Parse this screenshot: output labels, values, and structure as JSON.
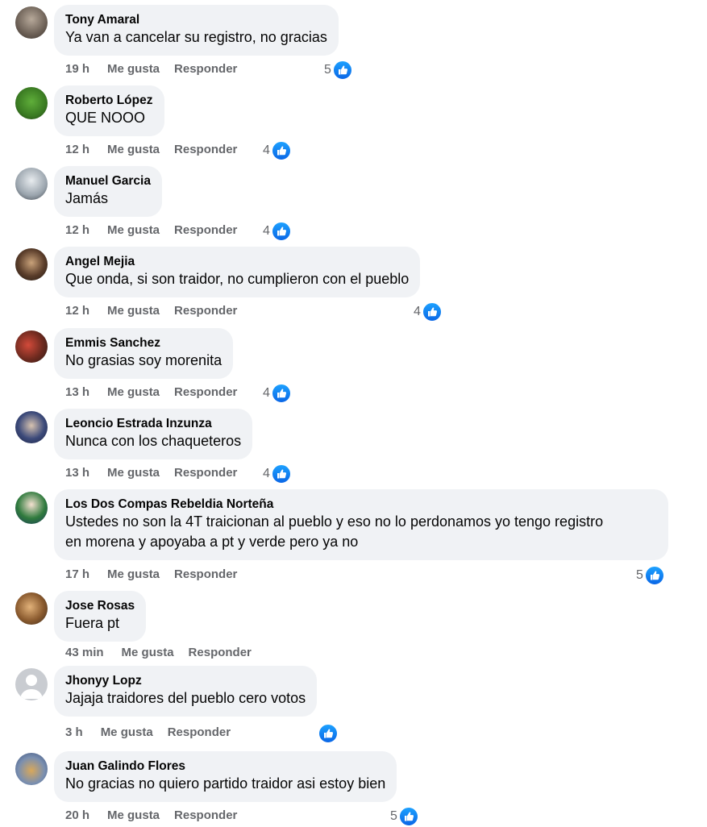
{
  "actions": {
    "like": "Me gusta",
    "reply": "Responder"
  },
  "comments": [
    {
      "author": "Tony Amaral",
      "text": "Ya van a cancelar su registro, no gracias",
      "time": "19 h",
      "likes": "5"
    },
    {
      "author": "Roberto López",
      "text": "QUE NOOO",
      "time": "12 h",
      "likes": "4"
    },
    {
      "author": "Manuel Garcia",
      "text": "Jamás",
      "time": "12 h",
      "likes": "4"
    },
    {
      "author": "Angel Mejia",
      "text": "Que onda, si son traidor, no cumplieron con el pueblo",
      "time": "12 h",
      "likes": "4"
    },
    {
      "author": "Emmis Sanchez",
      "text": "No grasias soy morenita",
      "time": "13 h",
      "likes": "4"
    },
    {
      "author": "Leoncio Estrada Inzunza",
      "text": "Nunca con los chaqueteros",
      "time": "13 h",
      "likes": "4"
    },
    {
      "author": "Los Dos Compas Rebeldia Norteña",
      "text_line1": "Ustedes no son la 4T traicionan al pueblo y eso no lo perdonamos yo tengo registro",
      "text_line2": "en morena y apoyaba a pt y verde pero ya no",
      "time": "17 h",
      "likes": "5"
    },
    {
      "author": "Jose Rosas",
      "text": "Fuera pt",
      "time": "43 min",
      "likes": ""
    },
    {
      "author": "Jhonyy Lopz",
      "text": "Jajaja traidores del pueblo cero votos",
      "time": "3 h",
      "likes": ""
    },
    {
      "author": "Juan Galindo Flores",
      "text": "No gracias no quiero partido traidor asi estoy bien",
      "time": "20 h",
      "likes": "5"
    }
  ],
  "colors": {
    "bubble": "#f0f2f5",
    "meta": "#65676b",
    "like": "#1877f2"
  },
  "icons": {
    "like": "thumbs-up-icon",
    "default_avatar": "person-silhouette-icon"
  }
}
